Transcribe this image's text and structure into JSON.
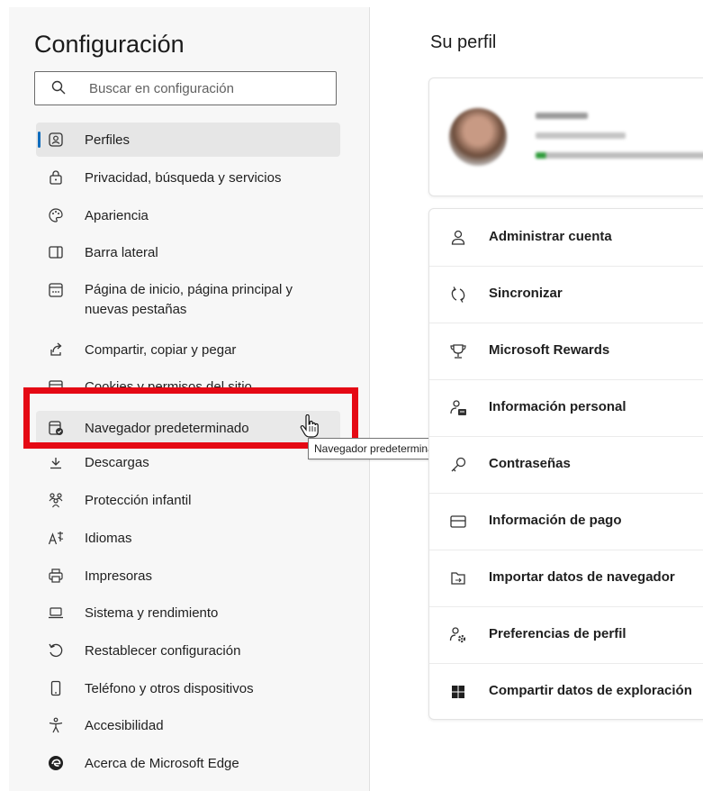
{
  "sidebar": {
    "title": "Configuración",
    "search_placeholder": "Buscar en configuración",
    "items": [
      {
        "label": "Perfiles"
      },
      {
        "label": "Privacidad, búsqueda y servicios"
      },
      {
        "label": "Apariencia"
      },
      {
        "label": "Barra lateral"
      },
      {
        "label": "Página de inicio, página principal y nuevas pestañas"
      },
      {
        "label": "Compartir, copiar y pegar"
      },
      {
        "label": "Cookies y permisos del sitio"
      },
      {
        "label": "Navegador predeterminado"
      },
      {
        "label": "Descargas"
      },
      {
        "label": "Protección infantil"
      },
      {
        "label": "Idiomas"
      },
      {
        "label": "Impresoras"
      },
      {
        "label": "Sistema y rendimiento"
      },
      {
        "label": "Restablecer configuración"
      },
      {
        "label": "Teléfono y otros dispositivos"
      },
      {
        "label": "Accesibilidad"
      },
      {
        "label": "Acerca de Microsoft Edge"
      }
    ]
  },
  "tooltip": "Navegador predeterminado",
  "main": {
    "title": "Su perfil",
    "menu": [
      {
        "label": "Administrar cuenta",
        "icon": "person-icon"
      },
      {
        "label": "Sincronizar",
        "icon": "sync-icon"
      },
      {
        "label": "Microsoft Rewards",
        "icon": "trophy-icon"
      },
      {
        "label": "Información personal",
        "icon": "personal-info-icon"
      },
      {
        "label": "Contraseñas",
        "icon": "key-icon"
      },
      {
        "label": "Información de pago",
        "icon": "card-icon"
      },
      {
        "label": "Importar datos de navegador",
        "icon": "import-icon"
      },
      {
        "label": "Preferencias de perfil",
        "icon": "profile-prefs-icon"
      },
      {
        "label": "Compartir datos de exploración",
        "icon": "windows-icon"
      }
    ]
  },
  "colors": {
    "accent": "#0f6cbd",
    "highlight": "#e50914"
  }
}
